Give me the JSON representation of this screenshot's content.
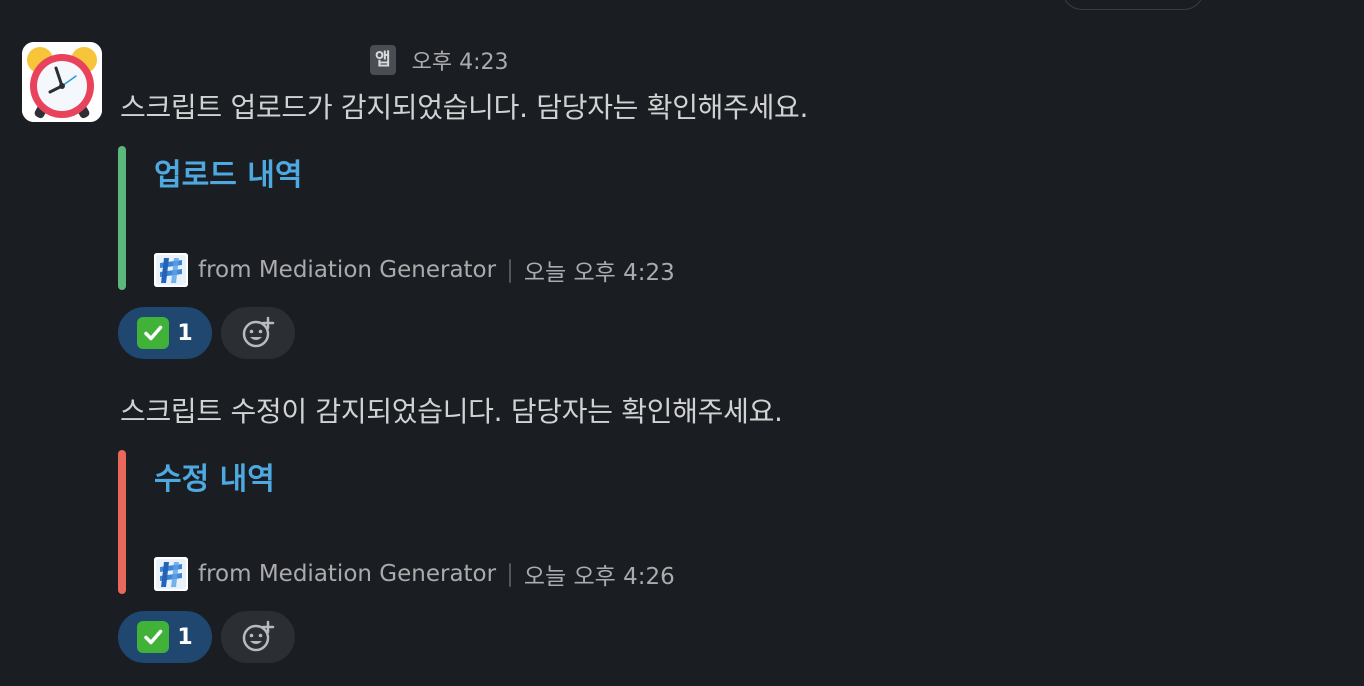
{
  "top_pill": "",
  "message": {
    "app_badge": "앱",
    "time": "오후 4:23"
  },
  "posts": [
    {
      "text": "스크립트 업로드가 감지되었습니다. 담당자는 확인해주세요.",
      "attachment": {
        "title": "업로드 내역",
        "bar_color": "#5cb87a",
        "footer_source": "from Mediation Generator",
        "footer_time": "오늘 오후 4:23"
      },
      "reactions": [
        {
          "emoji": "white-check-mark",
          "count": "1"
        }
      ]
    },
    {
      "text": "스크립트 수정이 감지되었습니다. 담당자는 확인해주세요.",
      "attachment": {
        "title": "수정 내역",
        "bar_color": "#e8685c",
        "footer_source": "from Mediation Generator",
        "footer_time": "오늘 오후 4:26"
      },
      "reactions": [
        {
          "emoji": "white-check-mark",
          "count": "1"
        }
      ]
    }
  ],
  "colors": {
    "background": "#1a1d21",
    "link": "#4ea9e0",
    "reaction_active": "#1f4770"
  }
}
